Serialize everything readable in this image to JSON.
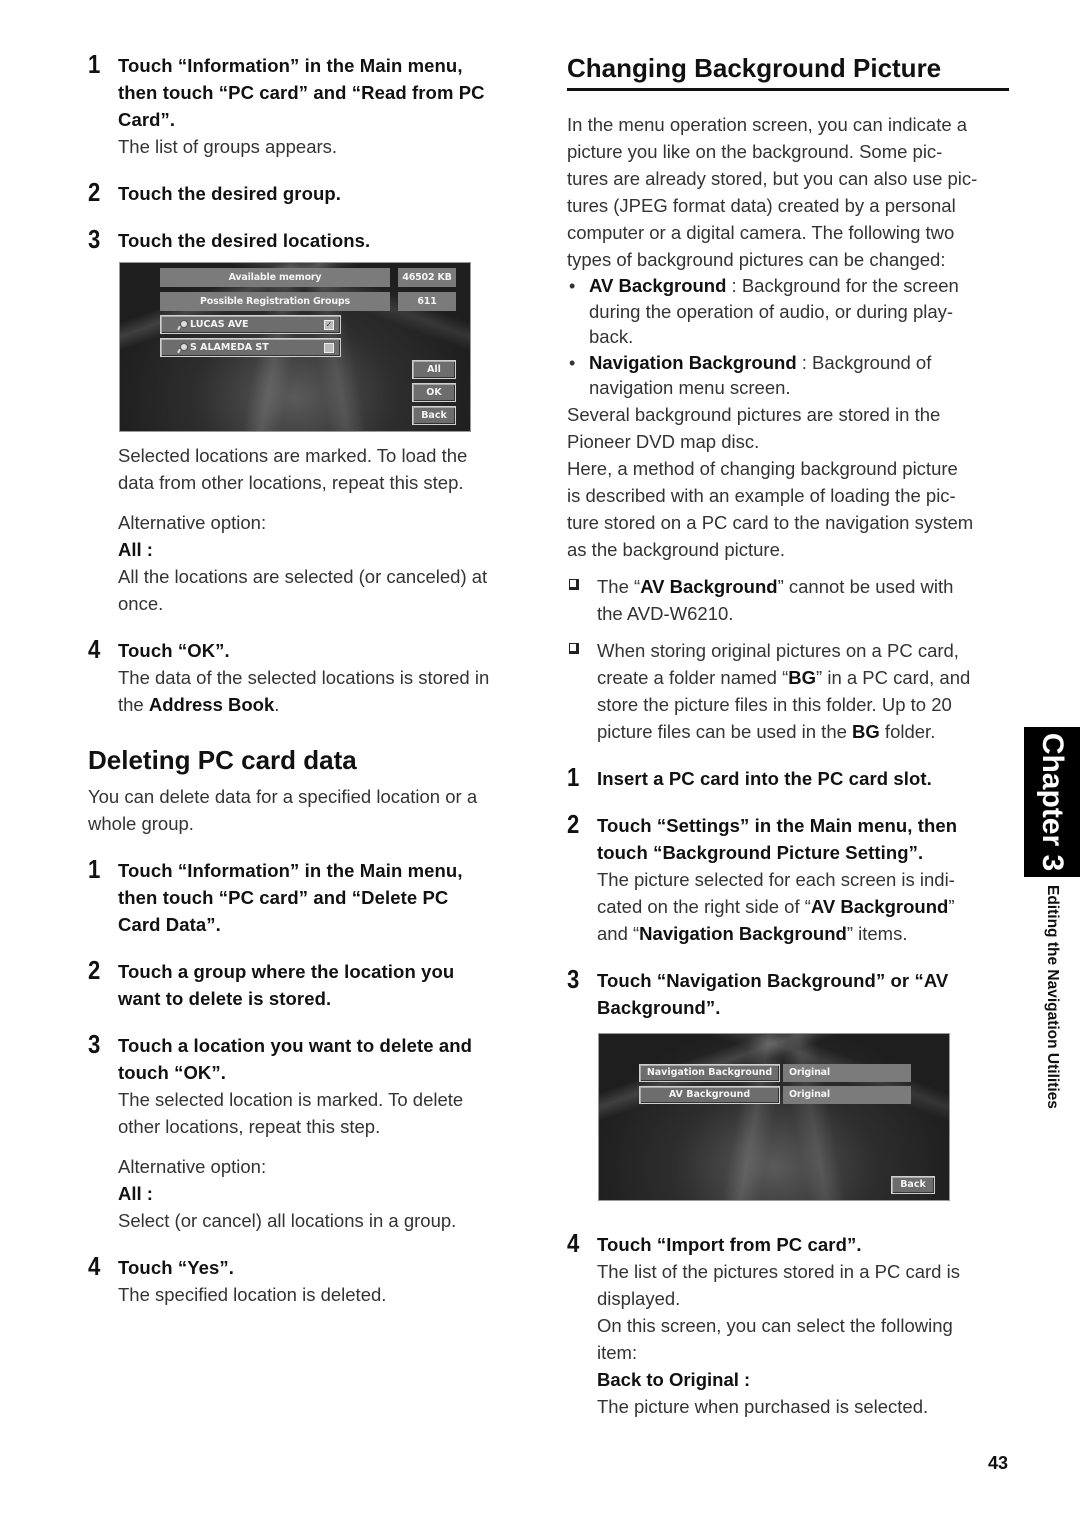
{
  "left_column": {
    "steps_a": [
      {
        "num": "1",
        "title_l1": "Touch “Information” in the Main menu,",
        "title_l2": "then touch “PC card” and “Read from PC",
        "title_l3": "Card”.",
        "body": "The list of groups appears."
      },
      {
        "num": "2",
        "title": "Touch the desired group."
      },
      {
        "num": "3",
        "title": "Touch the desired locations."
      }
    ],
    "screen1": {
      "info_rows": [
        {
          "label": "Available memory",
          "value": "46502 KB"
        },
        {
          "label": "Possible Registration Groups",
          "value": "611"
        }
      ],
      "locations": [
        {
          "name": "LUCAS AVE",
          "checked": true
        },
        {
          "name": "S ALAMEDA ST",
          "checked": false
        }
      ],
      "buttons": {
        "all": "All",
        "ok": "OK",
        "back": "Back"
      }
    },
    "after_screen": {
      "line1": "Selected locations are marked. To load the",
      "line2": "data from other locations, repeat this step.",
      "alt_label": "Alternative option:",
      "all_label": "All :",
      "all_desc_l1": "All the locations are selected (or canceled) at",
      "all_desc_l2": "once."
    },
    "step4": {
      "num": "4",
      "title": "Touch “OK”.",
      "body_l1": "The data of the selected locations is stored in",
      "body_l2_pre": "the ",
      "body_l2_bold": "Address Book",
      "body_l2_post": "."
    },
    "deleting": {
      "heading": "Deleting PC card data",
      "intro_l1": "You can delete data for a specified location or a",
      "intro_l2": "whole group.",
      "steps": [
        {
          "num": "1",
          "title_l1": "Touch “Information” in the Main menu,",
          "title_l2": "then touch “PC card” and “Delete PC",
          "title_l3": "Card Data”."
        },
        {
          "num": "2",
          "title_l1": "Touch a group where the location you",
          "title_l2": "want to delete is stored."
        },
        {
          "num": "3",
          "title_l1": "Touch a location you want to delete and",
          "title_l2": "touch “OK”.",
          "body_l1": "The selected location is marked. To delete",
          "body_l2": "other locations, repeat this step.",
          "alt_label": "Alternative option:",
          "all_label": "All :",
          "all_desc": "Select (or cancel) all locations in a group."
        },
        {
          "num": "4",
          "title": "Touch “Yes”.",
          "body": "The specified location is deleted."
        }
      ]
    }
  },
  "right_column": {
    "heading": "Changing Background Picture",
    "intro": [
      "In the menu operation screen, you can indicate a",
      "picture you like on the background. Some pic-",
      "tures are already stored, but you can also use pic-",
      "tures (JPEG format data) created by a personal",
      "computer or a digital camera. The following two",
      "types of background pictures can be changed:"
    ],
    "bullets": [
      {
        "bold": "AV Background",
        "text_l1": " : Background for the screen",
        "text_l2": "during the operation of audio, or during play-",
        "text_l3": "back."
      },
      {
        "bold": "Navigation Background",
        "text_l1": " : Background of",
        "text_l2": "navigation menu screen."
      }
    ],
    "para2": [
      "Several background pictures are stored in the",
      "Pioneer DVD map disc."
    ],
    "para3": [
      "Here, a method of changing background picture",
      "is described with an example of loading the pic-",
      "ture stored on a PC card to the navigation system",
      "as the background picture."
    ],
    "note1": {
      "pre": "The “",
      "bold": "AV Background",
      "post": "” cannot be used with",
      "l2": "the AVD-W6210."
    },
    "note2": {
      "l1": "When storing original pictures on a PC card,",
      "l2_pre": "create a folder named “",
      "l2_bold": "BG",
      "l2_post": "” in a PC card, and",
      "l3": "store the picture files in this folder. Up to 20",
      "l4_pre": "picture files can be used in the ",
      "l4_bold": "BG",
      "l4_post": " folder."
    },
    "steps": [
      {
        "num": "1",
        "title": "Insert a PC card into the PC card slot."
      },
      {
        "num": "2",
        "title_l1": "Touch “Settings” in the Main menu, then",
        "title_l2": "touch “Background Picture Setting”.",
        "body_l1": "The picture selected for each screen is indi-",
        "body_l2_pre": "cated on the right side of “",
        "body_l2_bold": "AV Background",
        "body_l2_post": "”",
        "body_l3_pre": "and “",
        "body_l3_bold": "Navigation Background",
        "body_l3_post": "” items."
      },
      {
        "num": "3",
        "title_l1": "Touch “Navigation Background” or “AV",
        "title_l2": "Background”."
      },
      {
        "num": "4",
        "title": "Touch “Import from PC card”.",
        "body_l1": "The list of the pictures stored in a PC card is",
        "body_l2": "displayed.",
        "body_l3": "On this screen, you can select the following",
        "body_l4": "item:",
        "option_label": "Back to Original :",
        "option_desc": "The picture when purchased is selected."
      }
    ],
    "screen2": {
      "rows": [
        {
          "button": "Navigation Background",
          "value": "Original"
        },
        {
          "button": "AV Background",
          "value": "Original"
        }
      ],
      "back": "Back"
    }
  },
  "side_tab": {
    "chapter": "Chapter 3",
    "section": "Editing the Navigation Utilities"
  },
  "page_number": "43"
}
